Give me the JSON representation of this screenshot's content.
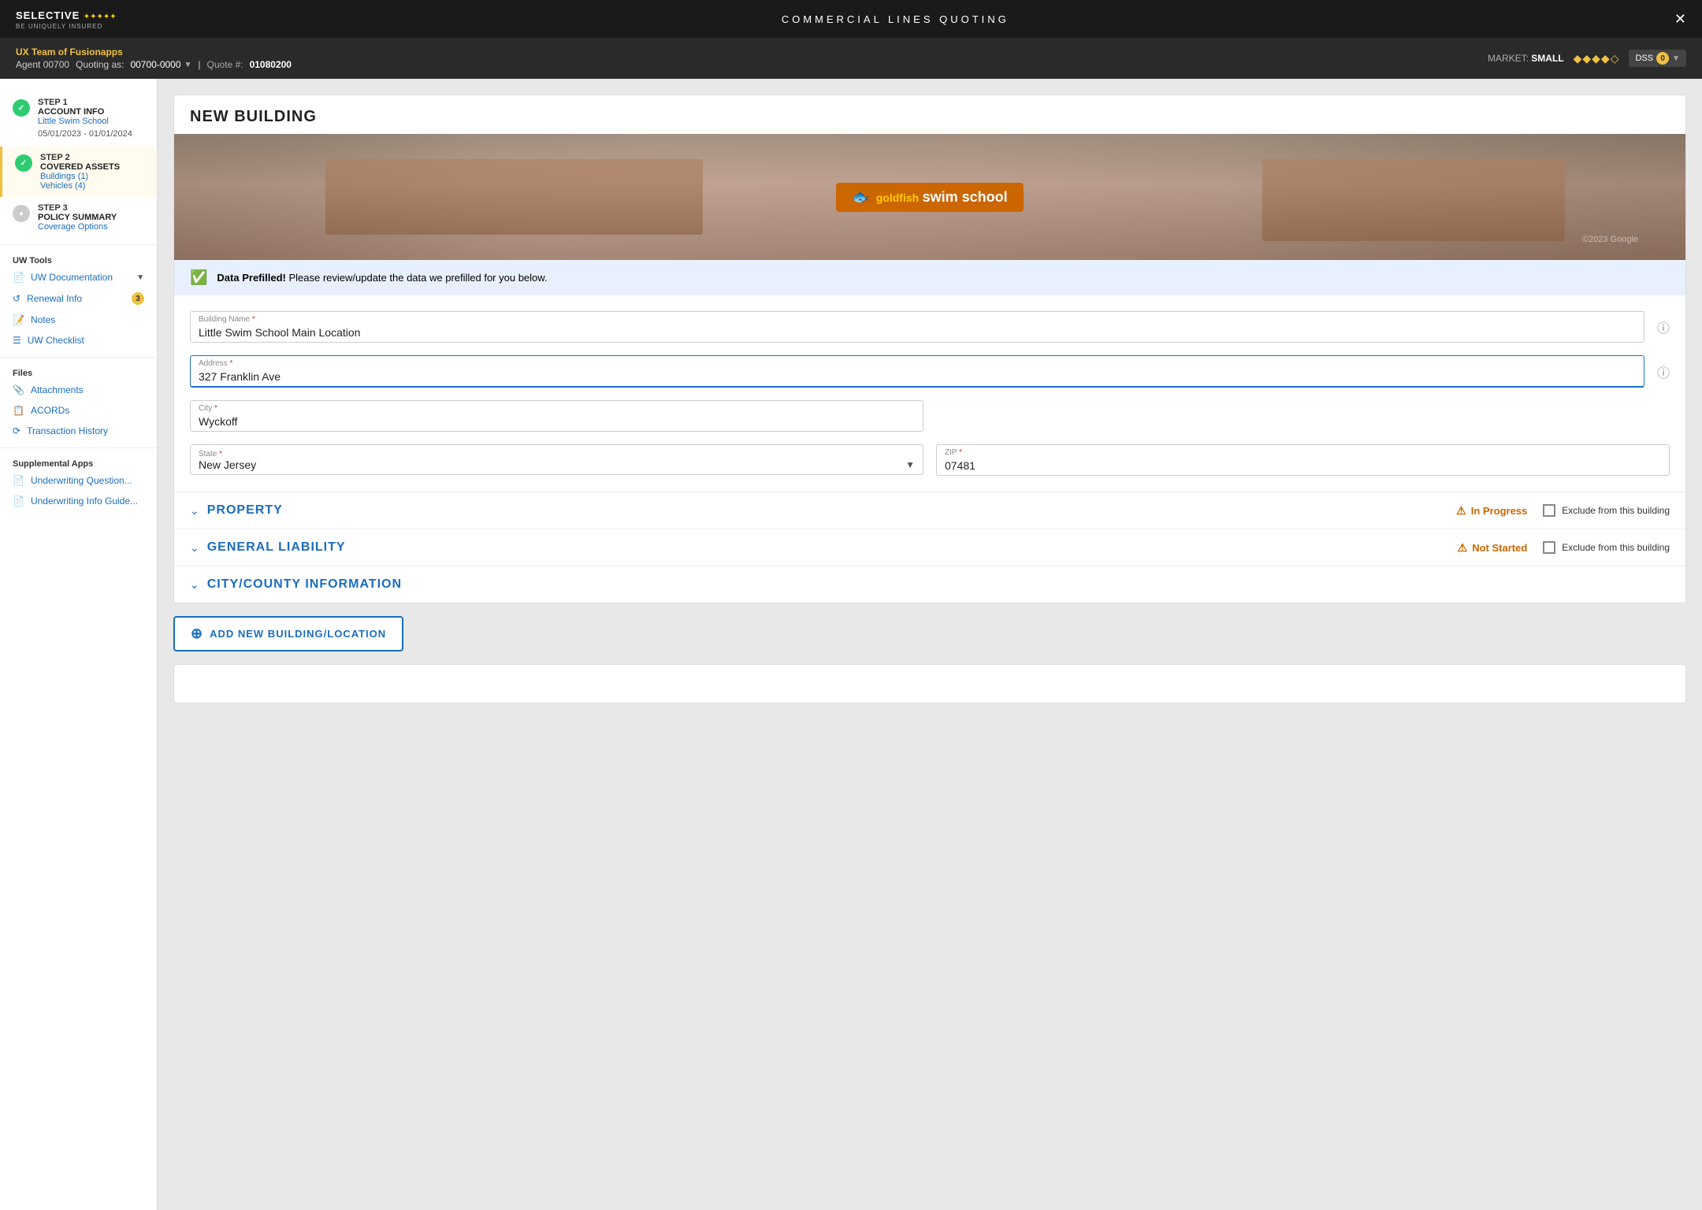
{
  "app": {
    "logo_text": "SELECTIVE",
    "logo_sub": "BE UNIQUELY INSURED",
    "logo_stars": "✦✦✦✦✦",
    "nav_title": "COMMERCIAL LINES QUOTING",
    "close_icon": "✕"
  },
  "subheader": {
    "agent_name": "UX Team of Fusionapps",
    "agent_label": "Agent",
    "agent_id": "00700",
    "quoting_label": "Quoting as:",
    "quoting_id": "00700-0000",
    "quote_label": "Quote #:",
    "quote_num": "01080200",
    "market_label": "MARKET:",
    "market_val": "SMALL",
    "diamonds": "◆◆◆◆◇",
    "dss_label": "DSS",
    "dss_count": "0"
  },
  "sidebar": {
    "steps": [
      {
        "id": "step1",
        "label": "STEP 1",
        "title": "ACCOUNT INFO",
        "link1": "Little Swim School",
        "link2": "05/01/2023 - 01/01/2024",
        "status": "complete"
      },
      {
        "id": "step2",
        "label": "STEP 2",
        "title": "COVERED ASSETS",
        "link1": "Buildings (1)",
        "link2": "Vehicles (4)",
        "status": "active"
      },
      {
        "id": "step3",
        "label": "STEP 3",
        "title": "POLICY SUMMARY",
        "link1": "Coverage Options",
        "status": "inactive"
      }
    ],
    "uw_tools_title": "UW Tools",
    "uw_tools": [
      {
        "id": "uw-doc",
        "label": "UW Documentation",
        "has_expand": true
      },
      {
        "id": "renewal-info",
        "label": "Renewal Info",
        "badge": "3"
      },
      {
        "id": "notes",
        "label": "Notes"
      },
      {
        "id": "uw-checklist",
        "label": "UW Checklist"
      }
    ],
    "files_title": "Files",
    "files": [
      {
        "id": "attachments",
        "label": "Attachments"
      },
      {
        "id": "acords",
        "label": "ACORDs"
      },
      {
        "id": "transaction-history",
        "label": "Transaction History"
      }
    ],
    "supplemental_title": "Supplemental Apps",
    "supplemental": [
      {
        "id": "uw-question",
        "label": "Underwriting Question..."
      },
      {
        "id": "uw-info-guide",
        "label": "Underwriting Info Guide..."
      }
    ]
  },
  "main": {
    "building_title": "NEW BUILDING",
    "prefilled_text": "Data Prefilled!",
    "prefilled_sub": "Please review/update the data we prefilled for you below.",
    "form": {
      "building_name_label": "Building Name",
      "building_name_required": "*",
      "building_name_value": "Little Swim School Main Location",
      "address_label": "Address",
      "address_required": "*",
      "address_value": "327 Franklin Ave",
      "city_label": "City",
      "city_required": "*",
      "city_value": "Wyckoff",
      "state_label": "State",
      "state_required": "*",
      "state_value": "New Jersey",
      "zip_label": "ZIP",
      "zip_required": "*",
      "zip_value": "07481"
    },
    "sections": [
      {
        "id": "property",
        "title": "PROPERTY",
        "status": "In Progress",
        "status_type": "in-progress",
        "exclude_label": "Exclude from this building"
      },
      {
        "id": "general-liability",
        "title": "GENERAL LIABILITY",
        "status": "Not Started",
        "status_type": "not-started",
        "exclude_label": "Exclude from this building"
      },
      {
        "id": "city-county",
        "title": "CITY/COUNTY INFORMATION",
        "status": "",
        "status_type": "",
        "exclude_label": ""
      }
    ],
    "add_building_label": "ADD NEW BUILDING/LOCATION"
  }
}
